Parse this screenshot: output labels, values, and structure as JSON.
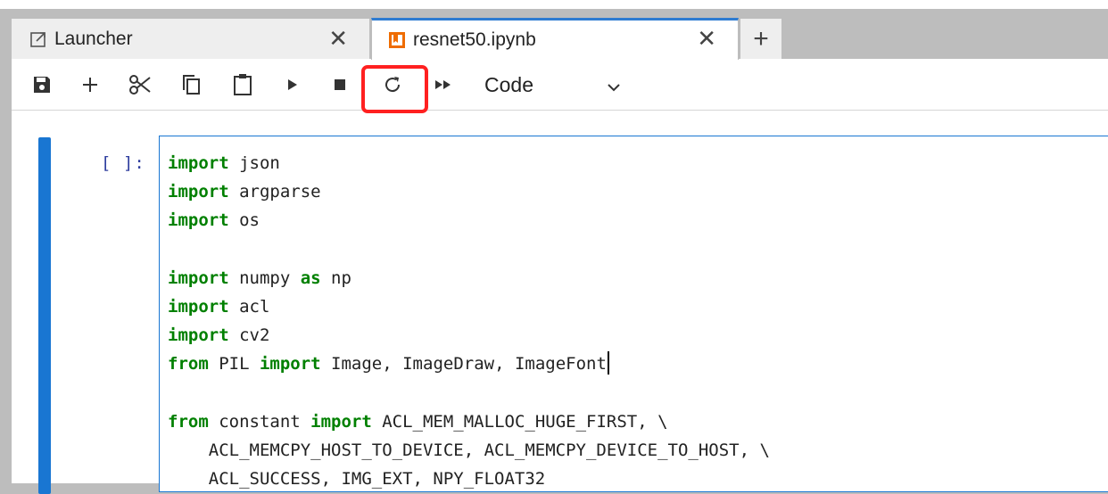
{
  "tabs": [
    {
      "label": "Launcher",
      "icon": "launcher-icon",
      "close": "✕",
      "active": false
    },
    {
      "label": "resnet50.ipynb",
      "icon": "notebook-icon",
      "close": "✕",
      "active": true
    }
  ],
  "new_tab": "+",
  "toolbar": {
    "buttons": [
      "save-icon",
      "add-icon",
      "cut-icon",
      "copy-icon",
      "paste-icon",
      "run-icon",
      "stop-icon",
      "restart-icon",
      "fast-forward-icon"
    ],
    "cell_type": "Code"
  },
  "cell": {
    "prompt": "[ ]:",
    "lines": [
      [
        {
          "t": "import",
          "k": true
        },
        {
          "t": " json"
        }
      ],
      [
        {
          "t": "import",
          "k": true
        },
        {
          "t": " argparse"
        }
      ],
      [
        {
          "t": "import",
          "k": true
        },
        {
          "t": " os"
        }
      ],
      [],
      [
        {
          "t": "import",
          "k": true
        },
        {
          "t": " numpy "
        },
        {
          "t": "as",
          "k": true
        },
        {
          "t": " np"
        }
      ],
      [
        {
          "t": "import",
          "k": true
        },
        {
          "t": " acl"
        }
      ],
      [
        {
          "t": "import",
          "k": true
        },
        {
          "t": " cv2"
        }
      ],
      [
        {
          "t": "from",
          "k": true
        },
        {
          "t": " PIL "
        },
        {
          "t": "import",
          "k": true
        },
        {
          "t": " Image, ImageDraw, ImageFont"
        },
        {
          "cursor": true
        }
      ],
      [],
      [
        {
          "t": "from",
          "k": true
        },
        {
          "t": " constant "
        },
        {
          "t": "import",
          "k": true
        },
        {
          "t": " ACL_MEM_MALLOC_HUGE_FIRST, \\"
        }
      ],
      [
        {
          "t": "    ACL_MEMCPY_HOST_TO_DEVICE, ACL_MEMCPY_DEVICE_TO_HOST, \\"
        }
      ],
      [
        {
          "t": "    ACL_SUCCESS, IMG_EXT, NPY_FLOAT32"
        }
      ]
    ]
  },
  "colors": {
    "keyword": "#008000",
    "accent": "#1976d2",
    "highlight": "#ff2020",
    "notebook_icon": "#e65100"
  }
}
